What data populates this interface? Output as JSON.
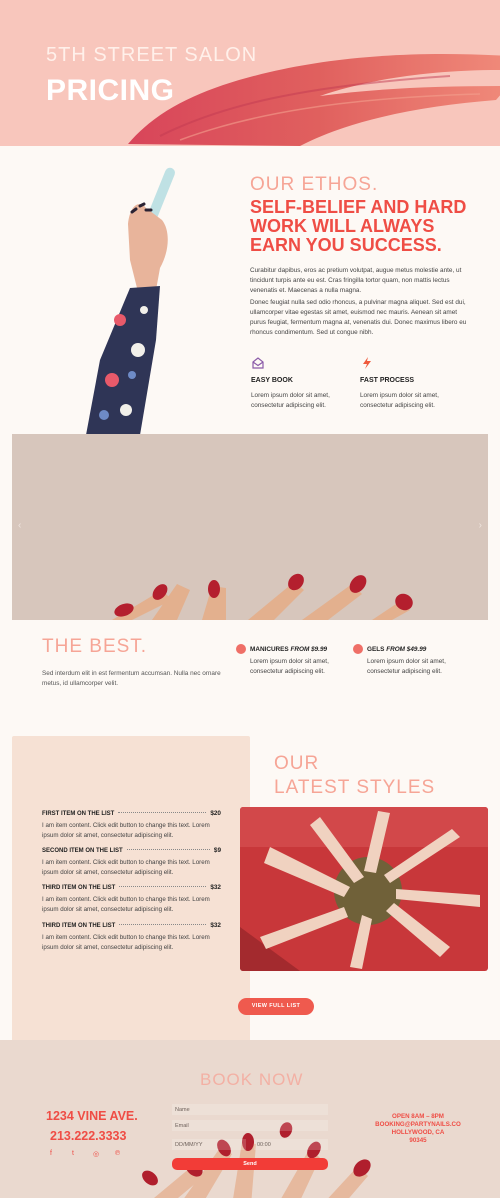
{
  "hero": {
    "eyebrow": "5TH STREET SALON",
    "title": "PRICING"
  },
  "ethos": {
    "eyebrow": "OUR ETHOS.",
    "headline": "SELF-BELIEF AND HARD WORK WILL ALWAYS EARN YOU SUCCESS.",
    "paragraph_1": "Curabitur dapibus, eros ac pretium volutpat, augue metus molestie ante, ut tincidunt turpis ante eu est. Cras fringilla tortor quam, non mattis lectus venenatis et. Maecenas a nulla magna.",
    "paragraph_2": "Donec feugiat nulla sed odio rhoncus, a pulvinar magna aliquet. Sed est dui, ullamcorper vitae egestas sit amet, euismod nec mauris. Aenean sit amet purus feugiat, fermentum magna at, venenatis dui. Donec maximus libero eu rhoncus condimentum. Sed ut congue nibh.",
    "features": [
      {
        "icon": "envelope-icon",
        "title": "EASY BOOK",
        "text": "Lorem ipsum dolor sit amet, consectetur adipiscing elit."
      },
      {
        "icon": "lightning-icon",
        "title": "FAST PROCESS",
        "text": "Lorem ipsum dolor sit amet, consectetur adipiscing elit."
      }
    ]
  },
  "slider": {
    "prev_icon": "chevron-left-icon",
    "next_icon": "chevron-right-icon",
    "prev_glyph": "‹",
    "next_glyph": "›"
  },
  "best": {
    "title": "THE BEST.",
    "text": "Sed interdum elit in est fermentum accumsan. Nulla nec ornare metus, id ullamcorper velit.",
    "items": [
      {
        "name": "MANICURES",
        "price": "FROM $9.99",
        "text": "Lorem ipsum dolor sit amet, consectetur adipiscing elit."
      },
      {
        "name": "GELS",
        "price": "FROM $49.99",
        "text": "Lorem ipsum dolor sit amet, consectetur adipiscing elit."
      }
    ]
  },
  "menu": {
    "items": [
      {
        "name": "FIRST ITEM ON THE LIST",
        "price": "$20",
        "desc": "I am item content. Click edit button to change this text. Lorem ipsum dolor sit amet, consectetur adipiscing elit."
      },
      {
        "name": "SECOND ITEM ON THE LIST",
        "price": "$9",
        "desc": "I am item content. Click edit button to change this text. Lorem ipsum dolor sit amet, consectetur adipiscing elit."
      },
      {
        "name": "THIRD ITEM ON THE LIST",
        "price": "$32",
        "desc": "I am item content. Click edit button to change this text. Lorem ipsum dolor sit amet, consectetur adipiscing elit."
      },
      {
        "name": "THIRD ITEM ON THE LIST",
        "price": "$32",
        "desc": "I am item content. Click edit button to change this text. Lorem ipsum dolor sit amet, consectetur adipiscing elit."
      }
    ]
  },
  "latest": {
    "line_1": "OUR",
    "line_2": "LATEST STYLES",
    "button": "VIEW FULL LIST"
  },
  "book": {
    "title": "BOOK NOW",
    "address": "1234 VINE AVE.",
    "phone": "213.222.3333",
    "hours": "OPEN 8AM – 8PM",
    "email": "BOOKING@PARTYNAILS.CO",
    "city": "HOLLYWOOD, CA",
    "zip": "90345",
    "form": {
      "name_placeholder": "Name",
      "email_placeholder": "Email",
      "date_placeholder": "DD/MM/YY",
      "time_placeholder": "00:00",
      "send_label": "Send"
    },
    "social": [
      {
        "icon": "facebook-icon",
        "glyph": "f"
      },
      {
        "icon": "twitter-icon",
        "glyph": "t"
      },
      {
        "icon": "instagram-icon",
        "glyph": "◎"
      },
      {
        "icon": "pinterest-icon",
        "glyph": "℗"
      }
    ]
  },
  "colors": {
    "accent": "#ef4d45",
    "peach": "#f8c6bc",
    "light_peach": "#f6a596",
    "panel": "#f6e1d4"
  }
}
